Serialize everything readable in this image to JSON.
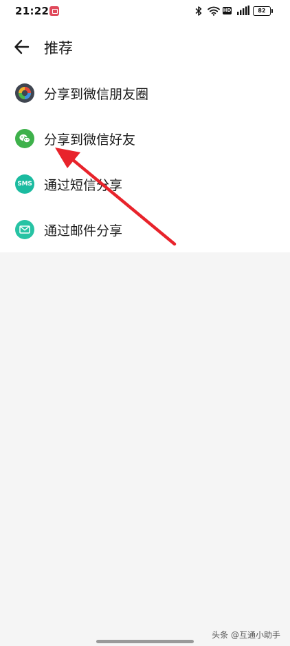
{
  "status_bar": {
    "time": "21:22",
    "network_type": "HD",
    "battery": "82"
  },
  "header": {
    "title": "推荐"
  },
  "share_options": [
    {
      "label": "分享到微信朋友圈",
      "icon": "wechat-moments-icon"
    },
    {
      "label": "分享到微信好友",
      "icon": "wechat-icon"
    },
    {
      "label": "通过短信分享",
      "icon": "sms-icon",
      "icon_text": "SMS"
    },
    {
      "label": "通过邮件分享",
      "icon": "mail-icon"
    }
  ],
  "watermark": "头条 @互通小助手",
  "colors": {
    "annotation_arrow": "#e8232b",
    "wechat_green": "#3eb14b",
    "sms_teal": "#1bbba0",
    "mail_teal": "#27c3a4"
  }
}
